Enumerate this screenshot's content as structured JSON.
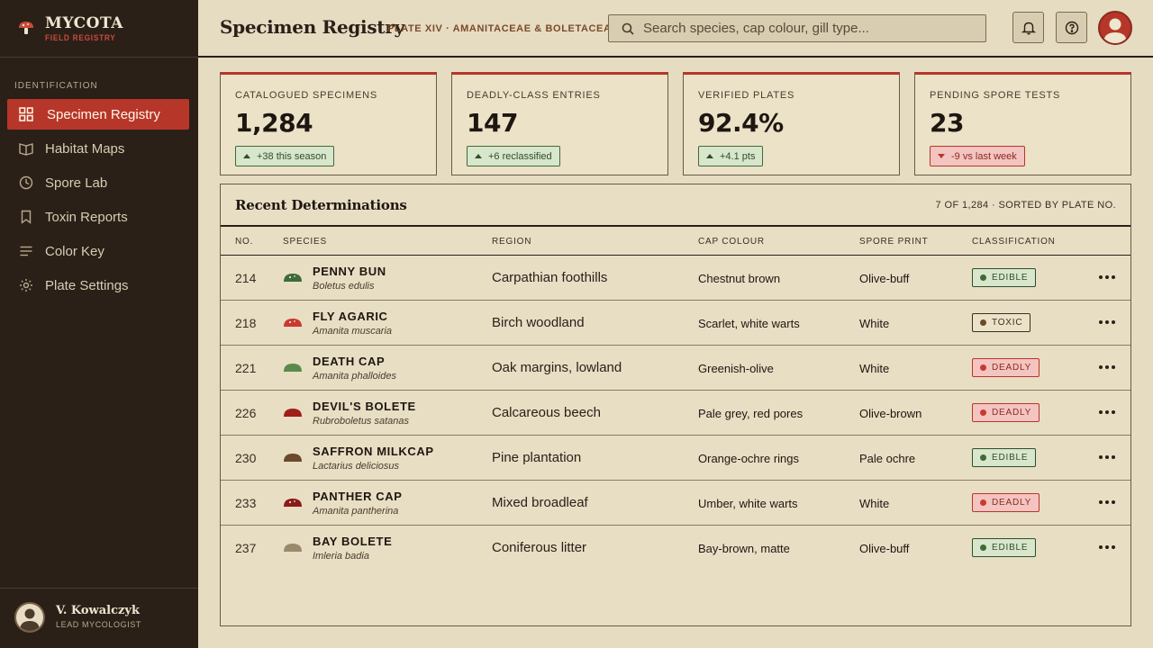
{
  "brand": {
    "name": "MYCOTA",
    "subtitle": "FIELD REGISTRY",
    "icon": "mushroom-icon"
  },
  "sidebar": {
    "section_label": "IDENTIFICATION",
    "items": [
      {
        "label": "Specimen Registry",
        "icon": "grid-icon",
        "active": true
      },
      {
        "label": "Habitat Maps",
        "icon": "book-open-icon"
      },
      {
        "label": "Spore Lab",
        "icon": "clock-icon"
      },
      {
        "label": "Toxin Reports",
        "icon": "bookmark-icon"
      },
      {
        "label": "Color Key",
        "icon": "lines-icon"
      },
      {
        "label": "Plate Settings",
        "icon": "gear-icon"
      }
    ]
  },
  "user": {
    "name": "V. Kowalczyk",
    "role": "LEAD MYCOLOGIST"
  },
  "header": {
    "title": "Specimen Registry",
    "plate": "PLATE XIV · AMANITACEAE & BOLETACEAE",
    "search_placeholder": "Search species, cap colour, gill type..."
  },
  "stats": [
    {
      "label": "CATALOGUED SPECIMENS",
      "value": "1,284",
      "delta": "+38 this season",
      "trend": "up"
    },
    {
      "label": "DEADLY-CLASS ENTRIES",
      "value": "147",
      "delta": "+6 reclassified",
      "trend": "up"
    },
    {
      "label": "VERIFIED PLATES",
      "value": "92.4%",
      "delta": "+4.1 pts",
      "trend": "up"
    },
    {
      "label": "PENDING SPORE TESTS",
      "value": "23",
      "delta": "-9 vs last week",
      "trend": "down"
    }
  ],
  "table": {
    "title": "Recent Determinations",
    "meta": "7 OF 1,284 · SORTED BY PLATE NO.",
    "columns": [
      "NO.",
      "SPECIES",
      "REGION",
      "CAP COLOUR",
      "SPORE PRINT",
      "CLASSIFICATION"
    ],
    "rows": [
      {
        "no": "214",
        "common": "PENNY BUN",
        "latin": "Boletus edulis",
        "region": "Carpathian foothills",
        "cap": "Chestnut brown",
        "spore": "Olive-buff",
        "class": "EDIBLE",
        "kind": "edible",
        "cap_color": "#3f6a3a",
        "warts": true
      },
      {
        "no": "218",
        "common": "FLY AGARIC",
        "latin": "Amanita muscaria",
        "region": "Birch woodland",
        "cap": "Scarlet, white warts",
        "spore": "White",
        "class": "TOXIC",
        "kind": "toxic",
        "cap_color": "#c83a30",
        "warts": true
      },
      {
        "no": "221",
        "common": "DEATH CAP",
        "latin": "Amanita phalloides",
        "region": "Oak margins, lowland",
        "cap": "Greenish-olive",
        "spore": "White",
        "class": "DEADLY",
        "kind": "deadly",
        "cap_color": "#5a8a4a",
        "warts": false
      },
      {
        "no": "226",
        "common": "DEVIL'S BOLETE",
        "latin": "Rubroboletus satanas",
        "region": "Calcareous beech",
        "cap": "Pale grey, red pores",
        "spore": "Olive-brown",
        "class": "DEADLY",
        "kind": "deadly",
        "cap_color": "#a01e1a",
        "warts": false
      },
      {
        "no": "230",
        "common": "SAFFRON MILKCAP",
        "latin": "Lactarius deliciosus",
        "region": "Pine plantation",
        "cap": "Orange-ochre rings",
        "spore": "Pale ochre",
        "class": "EDIBLE",
        "kind": "edible",
        "cap_color": "#6a4a2a",
        "warts": false
      },
      {
        "no": "233",
        "common": "PANTHER CAP",
        "latin": "Amanita pantherina",
        "region": "Mixed broadleaf",
        "cap": "Umber, white warts",
        "spore": "White",
        "class": "DEADLY",
        "kind": "deadly",
        "cap_color": "#8a1a18",
        "warts": true
      },
      {
        "no": "237",
        "common": "BAY BOLETE",
        "latin": "Imleria badia",
        "region": "Coniferous litter",
        "cap": "Bay-brown, matte",
        "spore": "Olive-buff",
        "class": "EDIBLE",
        "kind": "edible",
        "cap_color": "#9a8a6a",
        "warts": false
      }
    ]
  }
}
